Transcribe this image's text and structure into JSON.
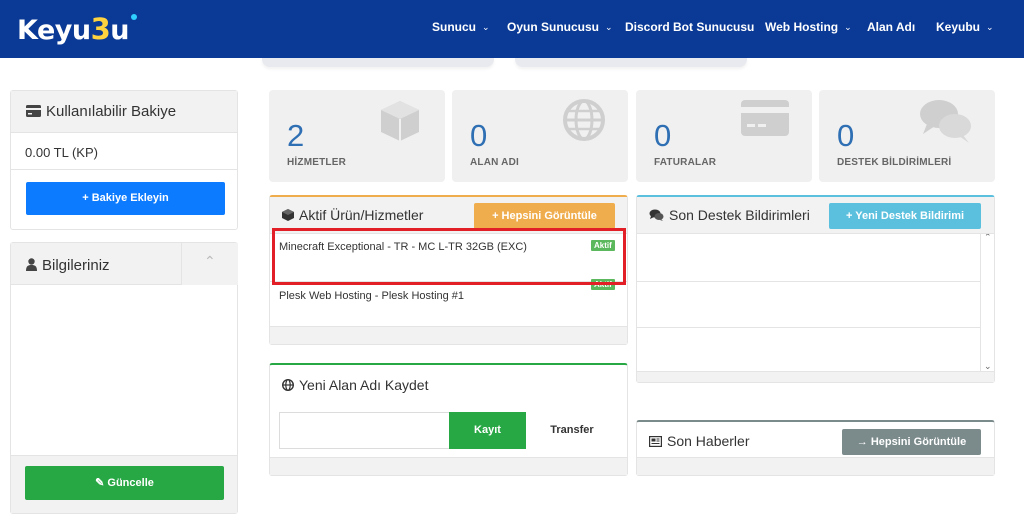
{
  "brand": {
    "logo_a": "Keyu",
    "logo_b": "3",
    "logo_c": "u"
  },
  "nav": {
    "items": [
      {
        "label": "Sunucu",
        "caret": "⌄"
      },
      {
        "label": "Oyun Sunucusu",
        "caret": "⌄"
      },
      {
        "label": "Discord Bot Sunucusu",
        "caret": ""
      },
      {
        "label": "Web Hosting",
        "caret": "⌄"
      },
      {
        "label": "Alan Adı",
        "caret": ""
      },
      {
        "label": "Keyubu",
        "caret": "⌄"
      }
    ]
  },
  "balance": {
    "title": "Kullanılabilir Bakiye",
    "amount": "0.00 TL (KP)",
    "add_button": "+ Bakiye Ekleyin"
  },
  "info": {
    "title": "Bilgileriniz",
    "toggle": "⌃",
    "update_button": "Güncelle"
  },
  "stats": [
    {
      "value": "2",
      "label": "HİZMETLER",
      "icon": "cube-icon"
    },
    {
      "value": "0",
      "label": "ALAN ADI",
      "icon": "globe-icon"
    },
    {
      "value": "0",
      "label": "FATURALAR",
      "icon": "credit-card-icon"
    },
    {
      "value": "0",
      "label": "DESTEK BİLDİRİMLERİ",
      "icon": "comments-icon"
    }
  ],
  "services": {
    "title": "Aktif Ürün/Hizmetler",
    "view_all": "+ Hepsini Görüntüle",
    "rows": [
      {
        "name": "Minecraft Exceptional - TR - MC L-TR 32GB (EXC)",
        "status": "Aktif"
      },
      {
        "name": "Plesk Web Hosting - Plesk Hosting #1",
        "status": "Aktif"
      }
    ]
  },
  "tickets": {
    "title": "Son Destek Bildirimleri",
    "new_button": "+ Yeni Destek Bildirimi"
  },
  "domain": {
    "title": "Yeni Alan Adı Kaydet",
    "input_value": "",
    "register_button": "Kayıt",
    "transfer_button": "Transfer"
  },
  "news": {
    "title": "Son Haberler",
    "view_all": "→ Hepsini Görüntüle"
  },
  "colors": {
    "nav_bg": "#0b3a96",
    "primary": "#0d7bff",
    "success": "#28a745",
    "warning": "#f0ad4e",
    "info": "#5bc0de",
    "muted": "#7b8a8b",
    "highlight": "#e21e26"
  }
}
